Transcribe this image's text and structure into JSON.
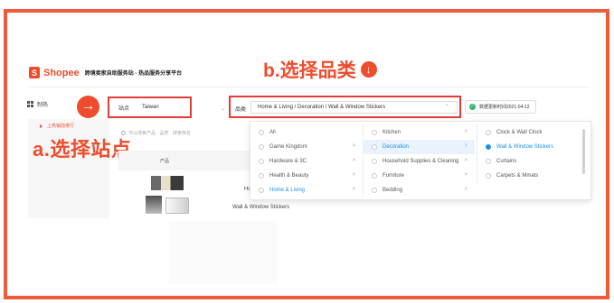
{
  "colors": {
    "frame": "#ee5a3c",
    "brand": "#ee4d2d",
    "highlight_box": "#e53a3a",
    "link_blue": "#1a8fe3",
    "check_green": "#2dbb6e"
  },
  "header": {
    "logo_text": "Shopee",
    "subtitle": "跨境卖家自助服务站 - 热品服务分享平台"
  },
  "annotations": {
    "step_b": "b.选择品类",
    "step_a": "a.选择站点",
    "down_arrow_icon": "arrow-down-circle",
    "right_arrow_icon": "arrow-right-circle"
  },
  "sidebar": {
    "dashboard_label": "制热",
    "item_label": "上热销前排行"
  },
  "filters": {
    "site_label": "站点",
    "site_value": "Taiwan",
    "category_label": "品类",
    "category_value": "Home & Living / Decoration / Wall & Window Stickers",
    "update_time": "数据更新时间2021-04-12"
  },
  "table": {
    "search_placeholder": "可以搜索产品 · 品类 · 搜索排名",
    "col_product": "产品",
    "product_hc": "Hc",
    "product_name": "Wall & Window Stickers"
  },
  "dropdown": {
    "col1": [
      {
        "label": "All",
        "has_children": false,
        "state": "normal"
      },
      {
        "label": "Game Kingdom",
        "has_children": true,
        "state": "normal"
      },
      {
        "label": "Hardware & 3C",
        "has_children": true,
        "state": "normal"
      },
      {
        "label": "Health & Beauty",
        "has_children": true,
        "state": "normal"
      },
      {
        "label": "Home & Living",
        "has_children": true,
        "state": "active"
      }
    ],
    "col2": [
      {
        "label": "Kitchen",
        "has_children": true,
        "state": "normal"
      },
      {
        "label": "Decoration",
        "has_children": true,
        "state": "highlight"
      },
      {
        "label": "Household Supplies & Cleaning",
        "has_children": true,
        "state": "normal"
      },
      {
        "label": "Furniture",
        "has_children": true,
        "state": "normal"
      },
      {
        "label": "Bedding",
        "has_children": true,
        "state": "normal"
      }
    ],
    "col3": [
      {
        "label": "Clock & Wall Clock",
        "state": "normal"
      },
      {
        "label": "Wall & Window Stickers",
        "state": "selected"
      },
      {
        "label": "Curtains",
        "state": "normal"
      },
      {
        "label": "Carpets & Mmats",
        "state": "normal"
      }
    ]
  }
}
